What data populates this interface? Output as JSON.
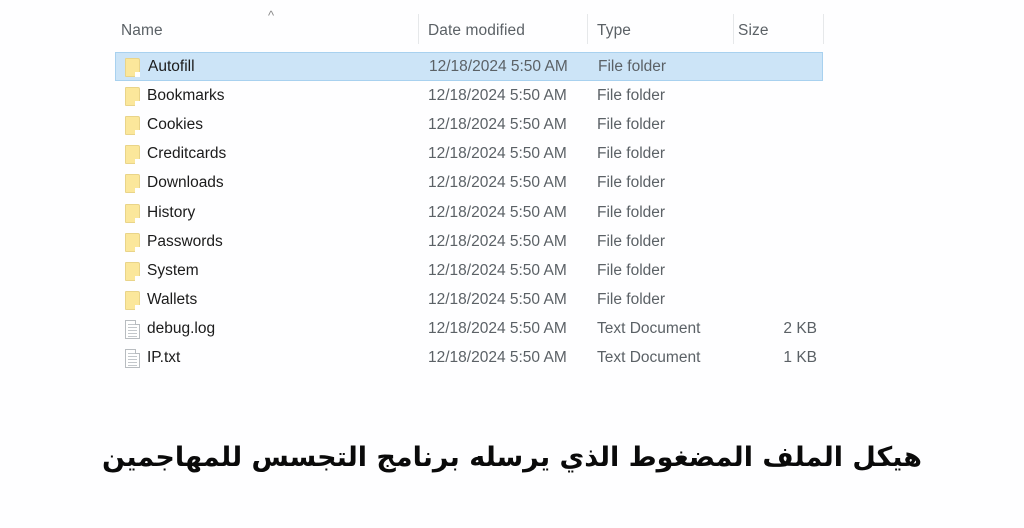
{
  "file_list": {
    "sort_indicator_icon": "chevron-up-icon",
    "columns": [
      {
        "key": "name",
        "label": "Name"
      },
      {
        "key": "date_modified",
        "label": "Date modified"
      },
      {
        "key": "type",
        "label": "Type"
      },
      {
        "key": "size",
        "label": "Size"
      }
    ],
    "selection_color": "#cce4f7",
    "rows": [
      {
        "icon": "folder-icon",
        "name": "Autofill",
        "date_modified": "12/18/2024 5:50 AM",
        "type": "File folder",
        "size": "",
        "selected": true
      },
      {
        "icon": "folder-icon",
        "name": "Bookmarks",
        "date_modified": "12/18/2024 5:50 AM",
        "type": "File folder",
        "size": "",
        "selected": false
      },
      {
        "icon": "folder-icon",
        "name": "Cookies",
        "date_modified": "12/18/2024 5:50 AM",
        "type": "File folder",
        "size": "",
        "selected": false
      },
      {
        "icon": "folder-icon",
        "name": "Creditcards",
        "date_modified": "12/18/2024 5:50 AM",
        "type": "File folder",
        "size": "",
        "selected": false
      },
      {
        "icon": "folder-icon",
        "name": "Downloads",
        "date_modified": "12/18/2024 5:50 AM",
        "type": "File folder",
        "size": "",
        "selected": false
      },
      {
        "icon": "folder-icon",
        "name": "History",
        "date_modified": "12/18/2024 5:50 AM",
        "type": "File folder",
        "size": "",
        "selected": false
      },
      {
        "icon": "folder-icon",
        "name": "Passwords",
        "date_modified": "12/18/2024 5:50 AM",
        "type": "File folder",
        "size": "",
        "selected": false
      },
      {
        "icon": "folder-icon",
        "name": "System",
        "date_modified": "12/18/2024 5:50 AM",
        "type": "File folder",
        "size": "",
        "selected": false
      },
      {
        "icon": "folder-icon",
        "name": "Wallets",
        "date_modified": "12/18/2024 5:50 AM",
        "type": "File folder",
        "size": "",
        "selected": false
      },
      {
        "icon": "text-document-icon",
        "name": "debug.log",
        "date_modified": "12/18/2024 5:50 AM",
        "type": "Text Document",
        "size": "2 KB",
        "selected": false
      },
      {
        "icon": "text-document-icon",
        "name": "IP.txt",
        "date_modified": "12/18/2024 5:50 AM",
        "type": "Text Document",
        "size": "1 KB",
        "selected": false
      }
    ]
  },
  "caption": {
    "text": "هيكل الملف المضغوط الذي يرسله برنامج التجسس للمهاجمين"
  }
}
